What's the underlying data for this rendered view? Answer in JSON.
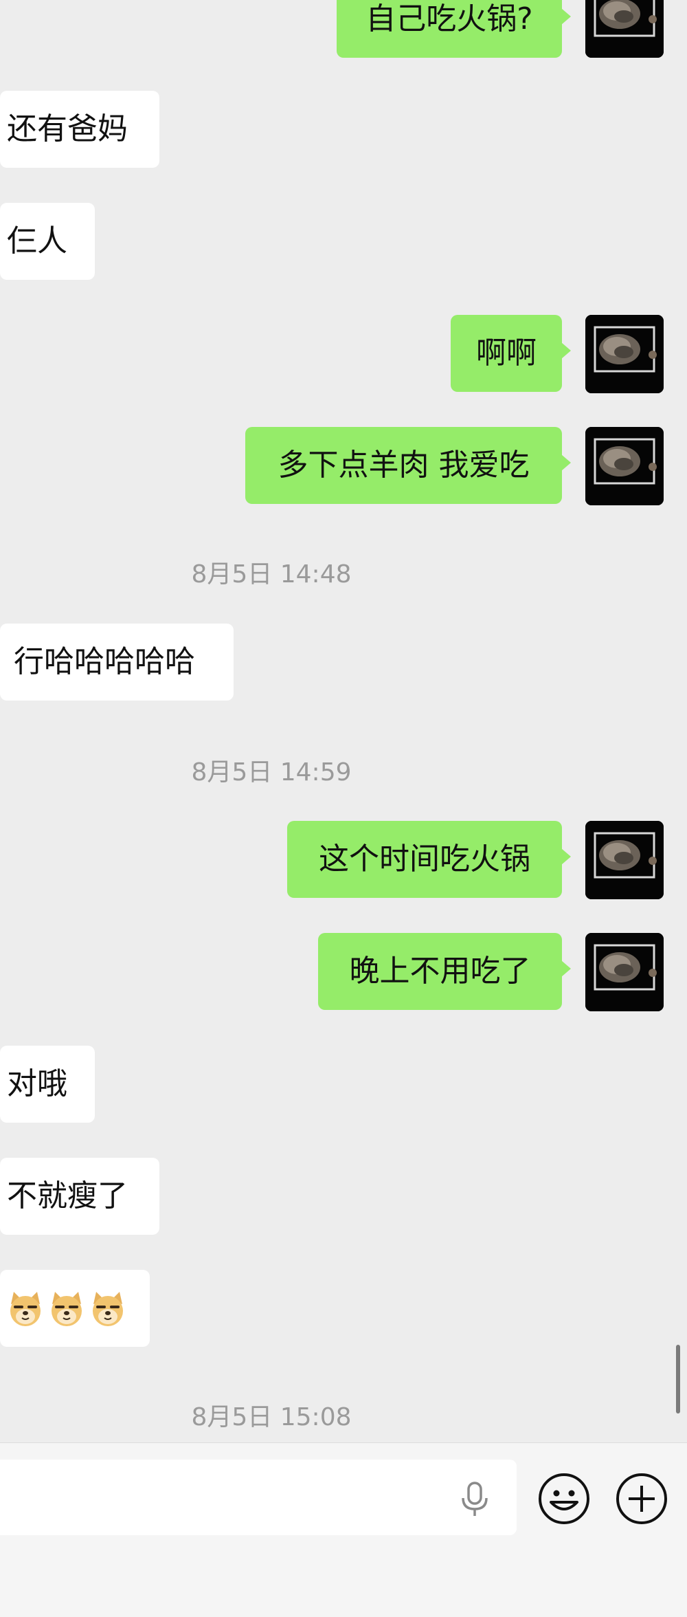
{
  "messages": [
    {
      "side": "me",
      "text": "自己吃火锅?"
    },
    {
      "side": "them",
      "text": "还有爸妈"
    },
    {
      "side": "them",
      "text": "仨人"
    },
    {
      "side": "me",
      "text": "啊啊"
    },
    {
      "side": "me",
      "text": "多下点羊肉 我爱吃"
    },
    {
      "type": "timestamp",
      "text": "8月5日 14:48"
    },
    {
      "side": "them",
      "text": "行哈哈哈哈哈"
    },
    {
      "type": "timestamp",
      "text": "8月5日 14:59"
    },
    {
      "side": "me",
      "text": "这个时间吃火锅"
    },
    {
      "side": "me",
      "text": "晚上不用吃了"
    },
    {
      "side": "them",
      "text": "对哦"
    },
    {
      "side": "them",
      "text": "不就瘦了"
    },
    {
      "side": "them",
      "type": "stickers",
      "icons": [
        "doge-emoji",
        "doge-emoji",
        "doge-emoji"
      ]
    },
    {
      "type": "timestamp",
      "text": "8月5日 15:08"
    }
  ],
  "input_bar": {
    "icons": [
      "microphone-icon",
      "smiley-icon",
      "plus-icon"
    ]
  },
  "colors": {
    "background": "#ededed",
    "my_bubble": "#95ec69",
    "their_bubble": "#ffffff",
    "timestamp": "#9a9a9a"
  }
}
